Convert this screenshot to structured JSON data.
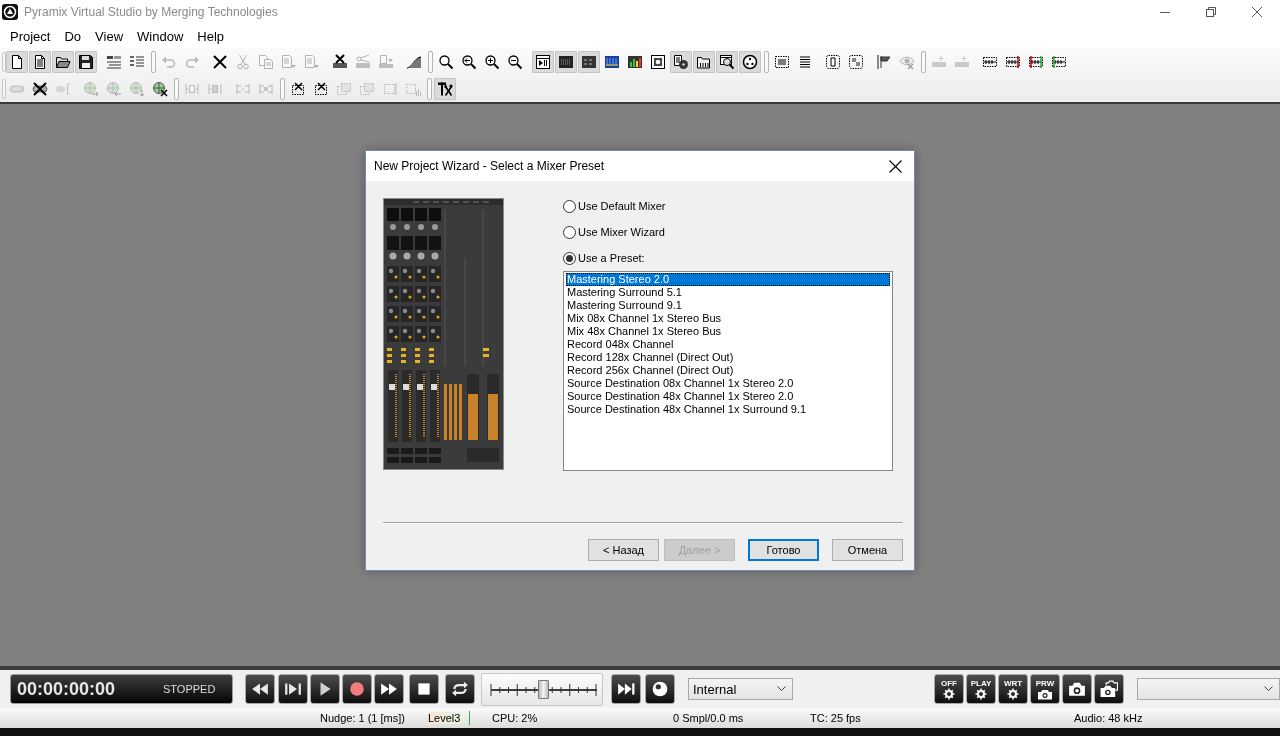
{
  "window": {
    "title": "Pyramix Virtual Studio by Merging Technologies"
  },
  "menu": [
    "Project",
    "Do",
    "View",
    "Window",
    "Help"
  ],
  "toolbars": [
    {
      "items": [
        {
          "kind": "button",
          "pressed": true,
          "disabled": false
        },
        {
          "kind": "button",
          "pressed": true,
          "disabled": false
        },
        {
          "kind": "button",
          "pressed": true,
          "disabled": false
        },
        {
          "kind": "button",
          "pressed": true,
          "disabled": false
        },
        {
          "kind": "button",
          "pressed": false,
          "disabled": false
        },
        {
          "kind": "button",
          "pressed": false,
          "disabled": false
        },
        {
          "kind": "separator"
        },
        {
          "kind": "button",
          "pressed": false,
          "disabled": true
        },
        {
          "kind": "button",
          "pressed": false,
          "disabled": true
        },
        {
          "kind": "button",
          "pressed": false,
          "disabled": false
        },
        {
          "kind": "button",
          "pressed": false,
          "disabled": true
        },
        {
          "kind": "button",
          "pressed": false,
          "disabled": true
        },
        {
          "kind": "button",
          "pressed": false,
          "disabled": true
        },
        {
          "kind": "button",
          "pressed": false,
          "disabled": true
        },
        {
          "kind": "button",
          "pressed": false,
          "disabled": false
        },
        {
          "kind": "button",
          "pressed": false,
          "disabled": true
        },
        {
          "kind": "button",
          "pressed": false,
          "disabled": true
        },
        {
          "kind": "button",
          "pressed": false,
          "disabled": false
        },
        {
          "kind": "separator"
        },
        {
          "kind": "button",
          "pressed": false,
          "disabled": false
        },
        {
          "kind": "button",
          "pressed": false,
          "disabled": false
        },
        {
          "kind": "button",
          "pressed": false,
          "disabled": false
        },
        {
          "kind": "button",
          "pressed": false,
          "disabled": false
        },
        {
          "kind": "button",
          "pressed": true,
          "disabled": false
        },
        {
          "kind": "button",
          "pressed": true,
          "disabled": false
        },
        {
          "kind": "button",
          "pressed": true,
          "disabled": false
        },
        {
          "kind": "button",
          "pressed": false,
          "disabled": false
        },
        {
          "kind": "button",
          "pressed": false,
          "disabled": false
        },
        {
          "kind": "button",
          "pressed": false,
          "disabled": false
        },
        {
          "kind": "button",
          "pressed": true,
          "disabled": false
        },
        {
          "kind": "button",
          "pressed": true,
          "disabled": false
        },
        {
          "kind": "button",
          "pressed": true,
          "disabled": false
        },
        {
          "kind": "button",
          "pressed": true,
          "disabled": false
        },
        {
          "kind": "separator"
        },
        {
          "kind": "button",
          "pressed": false,
          "disabled": false
        },
        {
          "kind": "button",
          "pressed": false,
          "disabled": false
        },
        {
          "kind": "button",
          "pressed": false,
          "disabled": false
        },
        {
          "kind": "button",
          "pressed": false,
          "disabled": false
        },
        {
          "kind": "button",
          "pressed": false,
          "disabled": false
        },
        {
          "kind": "button",
          "pressed": false,
          "disabled": true
        },
        {
          "kind": "separator"
        },
        {
          "kind": "button",
          "pressed": false,
          "disabled": true
        },
        {
          "kind": "button",
          "pressed": false,
          "disabled": true
        },
        {
          "kind": "button",
          "pressed": false,
          "disabled": false
        },
        {
          "kind": "button",
          "pressed": false,
          "disabled": false
        },
        {
          "kind": "button",
          "pressed": false,
          "disabled": false
        },
        {
          "kind": "button",
          "pressed": false,
          "disabled": false
        }
      ]
    },
    {
      "items": [
        {
          "kind": "button",
          "pressed": false,
          "disabled": true
        },
        {
          "kind": "button",
          "pressed": false,
          "disabled": false
        },
        {
          "kind": "button",
          "pressed": false,
          "disabled": true
        },
        {
          "kind": "button",
          "pressed": false,
          "disabled": true
        },
        {
          "kind": "button",
          "pressed": false,
          "disabled": true
        },
        {
          "kind": "button",
          "pressed": false,
          "disabled": true
        },
        {
          "kind": "button",
          "pressed": false,
          "disabled": false
        },
        {
          "kind": "separator"
        },
        {
          "kind": "button",
          "pressed": false,
          "disabled": true
        },
        {
          "kind": "button",
          "pressed": false,
          "disabled": true
        },
        {
          "kind": "button",
          "pressed": false,
          "disabled": true
        },
        {
          "kind": "button",
          "pressed": false,
          "disabled": true
        },
        {
          "kind": "separator"
        },
        {
          "kind": "button",
          "pressed": false,
          "disabled": false
        },
        {
          "kind": "button",
          "pressed": false,
          "disabled": false
        },
        {
          "kind": "button",
          "pressed": false,
          "disabled": true
        },
        {
          "kind": "button",
          "pressed": false,
          "disabled": true
        },
        {
          "kind": "button",
          "pressed": false,
          "disabled": true
        },
        {
          "kind": "button",
          "pressed": false,
          "disabled": true
        },
        {
          "kind": "separator"
        },
        {
          "kind": "button",
          "pressed": true,
          "disabled": false
        }
      ]
    }
  ],
  "dialog": {
    "title": "New Project Wizard - Select a Mixer Preset",
    "options": [
      {
        "label": "Use Default Mixer",
        "selected": false
      },
      {
        "label": "Use Mixer Wizard",
        "selected": false
      },
      {
        "label": "Use a Preset:",
        "selected": true
      }
    ],
    "presets": [
      {
        "label": "Mastering Stereo 2.0",
        "selected": true
      },
      {
        "label": "Mastering Surround 5.1",
        "selected": false
      },
      {
        "label": "Mastering Surround 9.1",
        "selected": false
      },
      {
        "label": "Mix 08x Channel 1x Stereo Bus",
        "selected": false
      },
      {
        "label": "Mix 48x Channel 1x Stereo Bus",
        "selected": false
      },
      {
        "label": "Record 048x Channel",
        "selected": false
      },
      {
        "label": "Record 128x Channel (Direct Out)",
        "selected": false
      },
      {
        "label": "Record 256x Channel (Direct Out)",
        "selected": false
      },
      {
        "label": "Source Destination 08x Channel 1x Stereo 2.0",
        "selected": false
      },
      {
        "label": "Source Destination 48x Channel 1x Stereo 2.0",
        "selected": false
      },
      {
        "label": "Source Destination 48x Channel 1x Surround 9.1",
        "selected": false
      }
    ],
    "buttons": [
      {
        "label": "< Назад",
        "disabled": false,
        "default": false
      },
      {
        "label": "Далее >",
        "disabled": true,
        "default": false
      },
      {
        "label": "Готово",
        "disabled": false,
        "default": true
      },
      {
        "label": "Отмена",
        "disabled": false,
        "default": false
      }
    ]
  },
  "transport": {
    "time": "00:00:00:00",
    "state": "STOPPED",
    "jog": {
      "level": 0.5
    },
    "sync_source": "Internal",
    "mode_buttons": [
      "OFF",
      "PLAY",
      "WRT",
      "PRW"
    ]
  },
  "status_bar": [
    "Nudge: 1 (1 [ms])",
    "Level3",
    "CPU: 2%",
    "0 Smpl/0.0 ms",
    "TC: 25 fps",
    "Audio: 48 kHz"
  ]
}
